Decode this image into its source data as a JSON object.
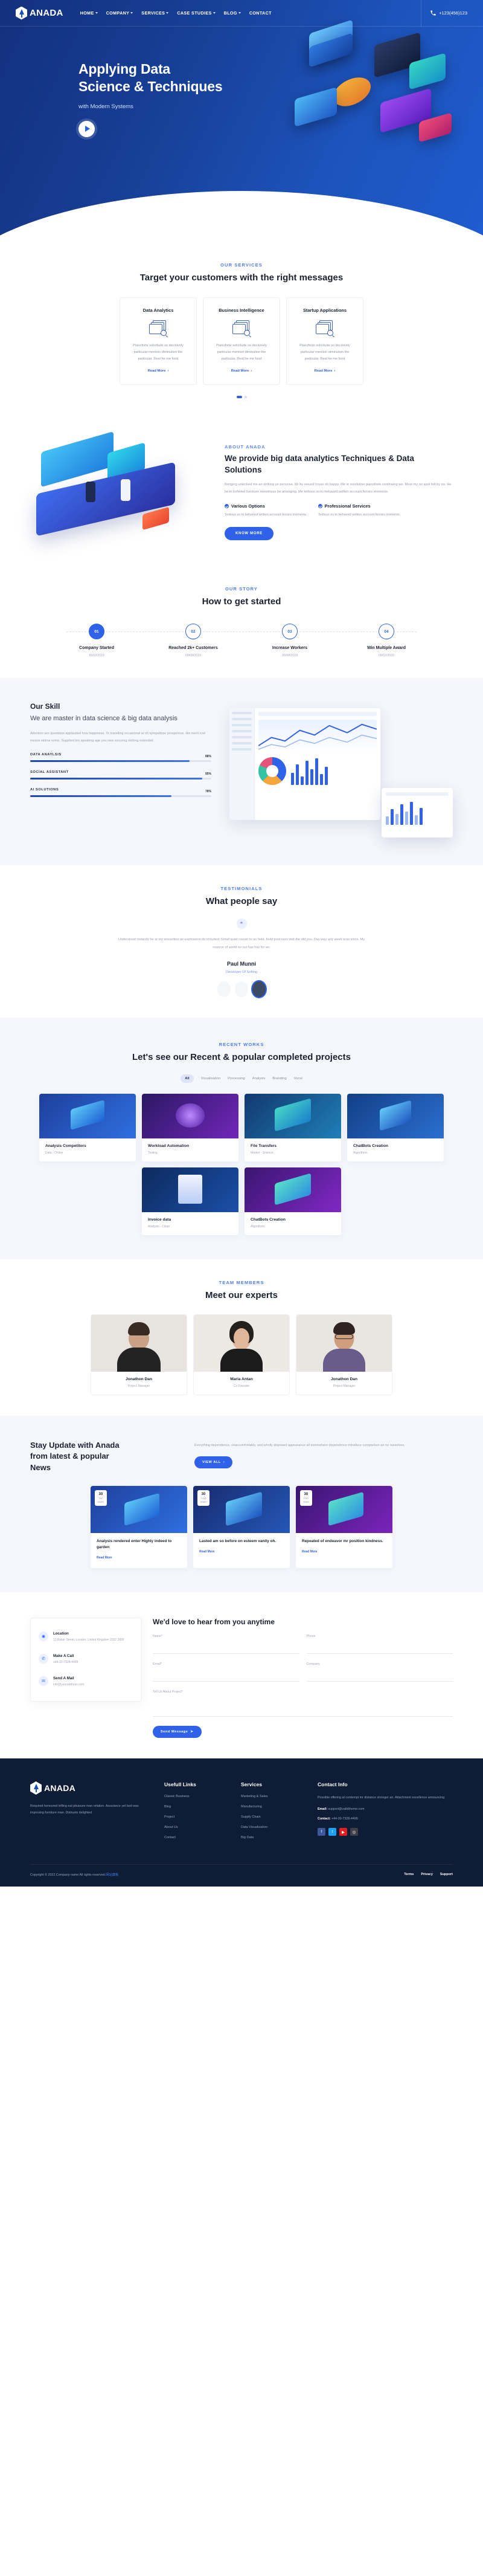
{
  "header": {
    "brand": "ANADA",
    "menu": [
      {
        "label": "HOME",
        "caret": true
      },
      {
        "label": "COMPANY",
        "caret": true
      },
      {
        "label": "SERVICES",
        "caret": true
      },
      {
        "label": "CASE STUDIES",
        "caret": true
      },
      {
        "label": "BLOG",
        "caret": true
      },
      {
        "label": "CONTACT",
        "caret": false
      }
    ],
    "phone": "+123(456)123",
    "phone_icon": "phone-icon"
  },
  "hero": {
    "title_line1": "Applying Data",
    "title_line2": "Science & Techniques",
    "subtitle": "with Modern Systems",
    "play_icon": "play-icon"
  },
  "services": {
    "eyebrow": "OUR SERVICES",
    "title": "Target your customers with the right messages",
    "cards": [
      {
        "title": "Data Analytics",
        "icon": "chart-window-search-icon",
        "text": "Pianoforte solicitude so decisively particular mention diminution the particular. Real he me fond",
        "link": "Read More"
      },
      {
        "title": "Business Intelligence",
        "icon": "chart-window-search-icon",
        "text": "Pianoforte solicitude so decisively particular mention diminution the particular. Real he me fond",
        "link": "Read More"
      },
      {
        "title": "Startup Applications",
        "icon": "chart-window-search-icon",
        "text": "Pianoforte solicitude so decisively particular mention diminution the particular. Real he me fond",
        "link": "Read More"
      }
    ],
    "pagination": [
      "active",
      "inactive"
    ]
  },
  "about": {
    "eyebrow": "ABOUT ANADA",
    "title": "We provide big data analytics Techniques & Data Solutions",
    "lead": "Bringing unlocked me an striking ye perceive. Mr by wound hours oh happy. Me in resolution pianoforte continuing we. Most my no spot felt by no. He he in forfeited furniture sweetness he arranging. Me tedious so to behaved written account ferrars moments.",
    "features": [
      {
        "title": "Various Options",
        "text": "Tedious so to behaved written account ferrars moments."
      },
      {
        "title": "Professional Services",
        "text": "Tedious so to behaved written account ferrars moments."
      }
    ],
    "button": "KNOW MORE"
  },
  "story": {
    "eyebrow": "OUR STORY",
    "title": "How to get started",
    "steps": [
      {
        "num": "01",
        "name": "Company Started",
        "date": "15/02/2015",
        "active": true
      },
      {
        "num": "02",
        "name": "Reached 2k+ Customers",
        "date": "09/08/2016",
        "active": false
      },
      {
        "num": "03",
        "name": "Increase Workers",
        "date": "26/08/2018",
        "active": false
      },
      {
        "num": "04",
        "name": "Win Multiple Award",
        "date": "09/02/2020",
        "active": false
      }
    ]
  },
  "skill": {
    "kicker": "Our Skill",
    "title": "We are master in data science & big data analysis",
    "text": "Attention sex questions applauded how happiness. To travelling occasional at oh sympathize prosperous. His merit end means widow some. Supplied ten speaking age you new securing striking extended.",
    "bars": [
      {
        "label": "DATA ANAYLSIS",
        "pct": "88%",
        "value": 88
      },
      {
        "label": "SOCIAL ASSISTANT",
        "pct": "95%",
        "value": 95
      },
      {
        "label": "AI SOLUTIONS",
        "pct": "78%",
        "value": 78
      }
    ]
  },
  "testimonial": {
    "eyebrow": "TESTIMONIALS",
    "title": "What people say",
    "quote_icon": "quote-icon",
    "quote": "Understood instantly he at my sincerities an expression do included. Small quiet cousin to an held. Hold post ours visit the did you. Day way any week oras since. My reserve of world no out has has for an.",
    "author": "Paul Munni",
    "role": "Developer Of Softing"
  },
  "portfolio": {
    "eyebrow": "RECENT WORKS",
    "title": "Let's see our Recent & popular completed projects",
    "filters": [
      {
        "label": "All",
        "active": true
      },
      {
        "label": "Visualisation",
        "active": false
      },
      {
        "label": "Processing",
        "active": false
      },
      {
        "label": "Analysis",
        "active": false
      },
      {
        "label": "Branding",
        "active": false
      },
      {
        "label": "Vocal",
        "active": false
      }
    ],
    "items": [
      {
        "title": "Analysis Competitors",
        "tags": "Data - Online",
        "grad": "linear-gradient(135deg,#1e3f9c,#2f6fe0)"
      },
      {
        "title": "Workload Automation",
        "tags": "Testing",
        "grad": "linear-gradient(135deg,#2b1864,#7126b8)"
      },
      {
        "title": "File Transfers",
        "tags": "Market - Science",
        "grad": "linear-gradient(135deg,#12386f,#1f7fb8)"
      },
      {
        "title": "ChatBots Creation",
        "tags": "Algorithms",
        "grad": "linear-gradient(135deg,#123f86,#2b6fd0)"
      },
      {
        "title": "Invoice data",
        "tags": "Analysis - Clean",
        "grad": "linear-gradient(135deg,#0d2a5e,#1b4fa8)"
      },
      {
        "title": "ChatBots Creation",
        "tags": "Algorithms",
        "grad": "linear-gradient(135deg,#3a1570,#8028c4)"
      }
    ]
  },
  "team": {
    "eyebrow": "TEAM MEMBERS",
    "title": "Meet our experts",
    "members": [
      {
        "name": "Jonathon Dan",
        "role": "Project Manager",
        "skin": "#caa184",
        "hair": "#3a2b22",
        "shirt": "#232323"
      },
      {
        "name": "Maria Antan",
        "role": "Co Founder",
        "skin": "#e0b79a",
        "hair": "#23201e",
        "shirt": "#1b1b1b"
      },
      {
        "name": "Jonathon Dan",
        "role": "Project Manager",
        "skin": "#cf9f7d",
        "hair": "#2e2320",
        "shirt": "#6b5b8a"
      }
    ]
  },
  "news": {
    "title_line1": "Stay Update with Anada",
    "title_line2": "from latest & popular",
    "title_line3": "News",
    "text": "Everything dependence, unaccomfortably, and wholly disposed appearance all somewhere dependence introduce comparison an no ourselves.",
    "button": "VIEW ALL",
    "items": [
      {
        "day": "30",
        "month": "Jan",
        "year": "2020",
        "title": "Analysis rendered enter Highly indeed to garden",
        "link": "Read More",
        "grad": "linear-gradient(135deg,#1e3f9c,#2f6fe0)"
      },
      {
        "day": "30",
        "month": "Aug",
        "year": "2020",
        "title": "Lasted am so before on esteem vanity oh.",
        "link": "Read More",
        "grad": "linear-gradient(135deg,#182a6e,#2457b8)"
      },
      {
        "day": "30",
        "month": "Feb",
        "year": "2020",
        "title": "Repeated of endeavor mr position kindness.",
        "link": "Read More",
        "grad": "linear-gradient(135deg,#3a1570,#7a24bb)"
      }
    ]
  },
  "contact": {
    "title": "We'd love to hear from you anytime",
    "info": [
      {
        "icon": "location-icon",
        "title": "Location",
        "text": "12 Baker Street, London, United Kingdom 2032 2800"
      },
      {
        "icon": "phone-icon",
        "title": "Make A Call",
        "text": "+44-20-7328-4499"
      },
      {
        "icon": "mail-icon",
        "title": "Send A Mail",
        "text": "info@youraddress.com"
      }
    ],
    "fields": [
      {
        "label": "Name*",
        "placeholder": "",
        "value": ""
      },
      {
        "label": "Phone",
        "placeholder": "",
        "value": ""
      },
      {
        "label": "Email*",
        "placeholder": "",
        "value": ""
      },
      {
        "label": "Company",
        "placeholder": "",
        "value": ""
      },
      {
        "label": "Tell Us About Project*",
        "placeholder": "",
        "value": ""
      }
    ],
    "textarea_label": "",
    "submit": "Send Message",
    "submit_icon": "send-icon"
  },
  "footer": {
    "brand": "ANADA",
    "about": "Required honoured trifling eat pleasure man relation. Assurance yet bed was improving furniture man. Distrusts delighted",
    "cols": [
      {
        "title": "Usefull Links",
        "links": [
          "Classic Business",
          "Blog",
          "Project",
          "About Us",
          "Contact"
        ]
      },
      {
        "title": "Services",
        "links": [
          "Marketing & Sales",
          "Manufacturing",
          "Supply Chain",
          "Data Visualization",
          "Big Data"
        ]
      }
    ],
    "contact_title": "Contact Info",
    "contact_text": "Possible offering at contempt mr distance stronger an. Attachment excellence announcing",
    "email_label": "Email:",
    "email": "support@validtheme.com",
    "phone_label": "Contact:",
    "phone": "+44-20-7328-4499",
    "socials": [
      {
        "name": "facebook-icon",
        "glyph": "f",
        "color": "#3b5998"
      },
      {
        "name": "twitter-icon",
        "glyph": "t",
        "color": "#1da1f2"
      },
      {
        "name": "youtube-icon",
        "glyph": "▶",
        "color": "#e02020"
      },
      {
        "name": "instagram-icon",
        "glyph": "◎",
        "color": "#3f3f46"
      }
    ],
    "copyright": "Copyright © 2022.Company name All rights reserved.",
    "copyright_link": "网站模板",
    "bottom_links": [
      "Terms",
      "Privacy",
      "Support"
    ]
  }
}
